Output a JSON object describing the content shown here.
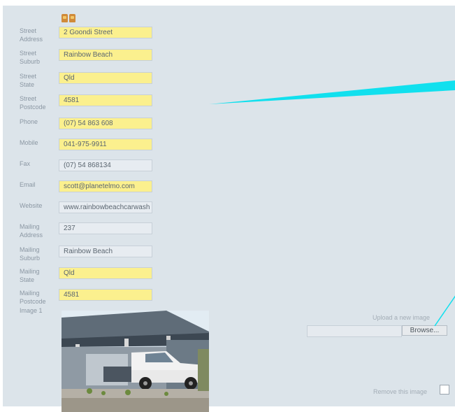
{
  "fields": [
    {
      "label": "Street\nAddress",
      "value": "2 Goondi Street",
      "highlight": true
    },
    {
      "label": "Street\nSuburb",
      "value": "Rainbow Beach",
      "highlight": true
    },
    {
      "label": "Street\nState",
      "value": "Qld",
      "highlight": true
    },
    {
      "label": "Street\nPostcode",
      "value": "4581",
      "highlight": true
    },
    {
      "label": "Phone",
      "value": "(07) 54 863 608",
      "highlight": true
    },
    {
      "label": "Mobile",
      "value": "041-975-9911",
      "highlight": true
    },
    {
      "label": "Fax",
      "value": "(07) 54 868134",
      "highlight": false
    },
    {
      "label": "Email",
      "value": "scott@planetelmo.com",
      "highlight": true
    },
    {
      "label": "Website",
      "value": "www.rainbowbeachcarwash",
      "highlight": false
    },
    {
      "label": "Mailing\nAddress",
      "value": "237",
      "highlight": false
    },
    {
      "label": "Mailing\nSuburb",
      "value": "Rainbow Beach",
      "highlight": false
    },
    {
      "label": "Mailing\nState",
      "value": "Qld",
      "highlight": true
    },
    {
      "label": "Mailing\nPostcode",
      "value": "4581",
      "highlight": true
    }
  ],
  "image": {
    "label": "Image 1"
  },
  "upload": {
    "label": "Upload a new image",
    "browse_label": "Browse..."
  },
  "remove": {
    "label": "Remove this image"
  },
  "colors": {
    "panel": "#dce4ea",
    "highlight_field": "#fbf08e",
    "plain_field": "#e7ecf1",
    "arrow": "#11e0ee"
  }
}
